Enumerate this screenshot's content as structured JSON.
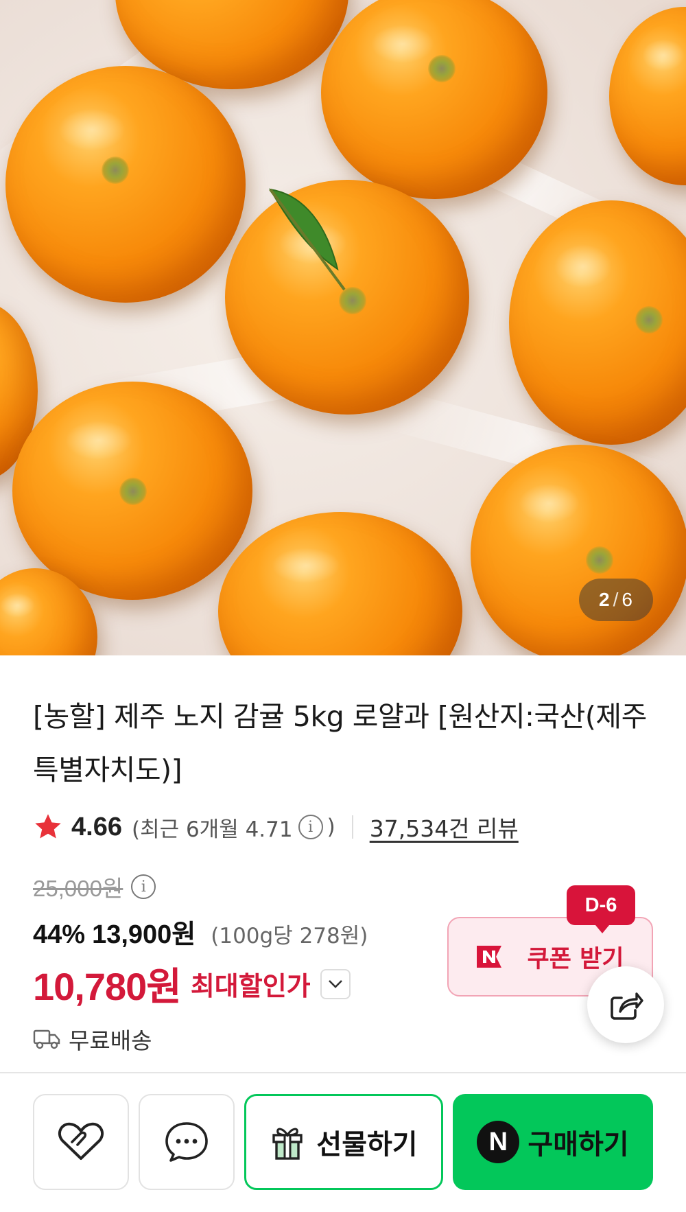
{
  "hero": {
    "image_alt": "oranges on white cloth",
    "page_current": "2",
    "page_separator": "/",
    "page_total": "6"
  },
  "product": {
    "title": "[농할] 제주 노지 감귤 5kg 로얄과 [원산지:국산(제주특별자치도)]",
    "rating": "4.66",
    "recent_rating_label": "(최근 6개월 4.71",
    "recent_rating_close": ")",
    "review_count": "37,534건 리뷰",
    "original_price": "25,000원",
    "discount_percent": "44%",
    "sale_price": "13,900원",
    "unit_price": "(100g당 278원)",
    "max_discount_price": "10,780원",
    "max_discount_label": "최대할인가",
    "shipping": "무료배송"
  },
  "coupon": {
    "dday": "D-6",
    "label": "쿠폰 받기"
  },
  "bottom_bar": {
    "gift_label": "선물하기",
    "buy_label": "구매하기",
    "buy_logo": "N"
  },
  "colors": {
    "accent_red": "#d3193a",
    "naver_green": "#03c75a"
  },
  "icons": [
    "star-icon",
    "info-icon",
    "chevron-down-icon",
    "truck-icon",
    "naver-n-icon",
    "share-icon",
    "heart-icon",
    "chat-icon",
    "gift-icon"
  ]
}
